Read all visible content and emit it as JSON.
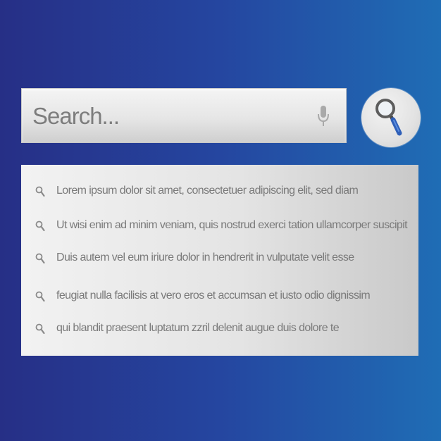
{
  "search": {
    "placeholder": "Search...",
    "mic_icon": "microphone-icon",
    "button_icon": "magnifier-icon"
  },
  "suggestions": [
    {
      "icon": "search-icon",
      "text": "Lorem ipsum dolor sit amet, consectetuer adipiscing elit, sed diam"
    },
    {
      "icon": "search-icon",
      "text": "Ut wisi enim ad minim veniam, quis nostrud exerci tation ullamcorper suscipit"
    },
    {
      "icon": "search-icon",
      "text": "Duis autem vel eum iriure dolor in hendrerit in vulputate velit esse"
    },
    {
      "icon": "search-icon",
      "text": "feugiat nulla facilisis at vero eros et accumsan et iusto odio dignissim"
    },
    {
      "icon": "search-icon",
      "text": "qui blandit praesent luptatum zzril delenit augue duis dolore te"
    }
  ],
  "colors": {
    "background_start": "#262f86",
    "background_end": "#1f6db5",
    "accent_blue": "#2f5fb8",
    "text_gray": "#7a7a7a"
  }
}
